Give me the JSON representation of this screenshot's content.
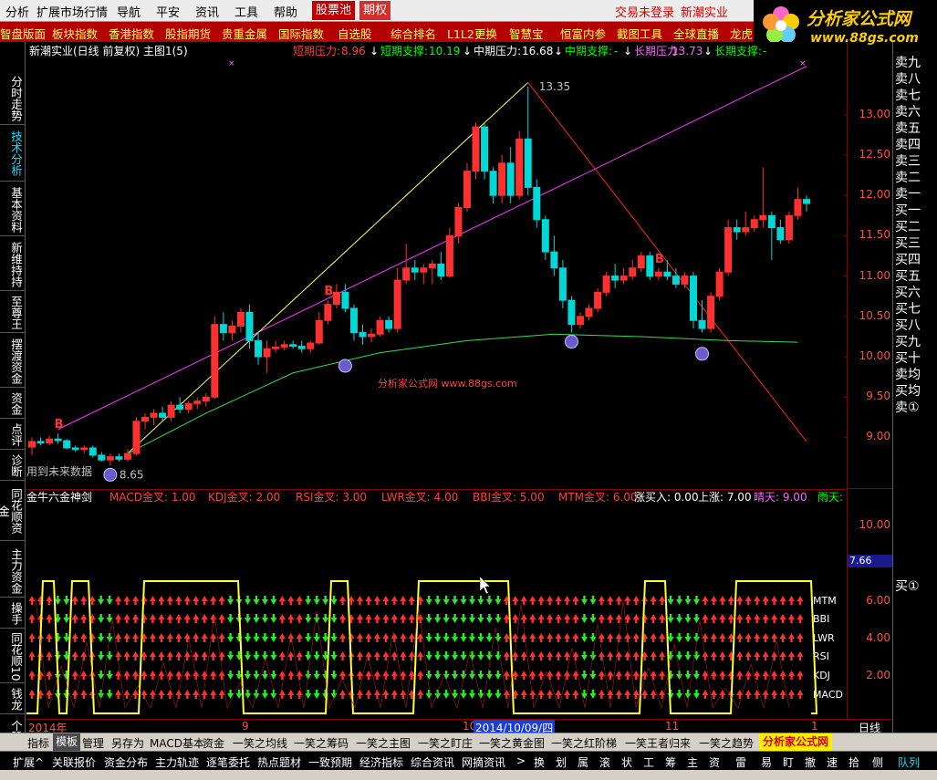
{
  "menu": {
    "items": [
      "分析",
      "扩展市场行情",
      "导航",
      "平安",
      "资讯",
      "工具",
      "帮助",
      "股票池",
      "期权"
    ],
    "status_login": "交易未登录",
    "status_stock": "新潮实业"
  },
  "quickbar": [
    "智盘版面",
    "板块指数",
    "香港指数",
    "股指期货",
    "贵重金属",
    "国际指数",
    "自选股",
    "综合排名",
    "L1L2更换",
    "智慧宝",
    "恒富内参",
    "截图工具",
    "全球直播",
    "龙虎"
  ],
  "logo": {
    "title": "分析家公式网",
    "url": "www.88gs.com"
  },
  "leftnav": [
    "分时走势",
    "技术分析",
    "基本资料",
    "新维持持",
    "至尊王",
    "摆渡资金",
    "资金",
    "点评",
    "诊断",
    "同花顺资金",
    "主力资金",
    "操手",
    "同花顺10",
    "钱龙",
    "个股"
  ],
  "rightnav": [
    "卖九",
    "卖八",
    "卖七",
    "卖六",
    "卖五",
    "卖四",
    "卖三",
    "卖二",
    "卖一",
    "买一",
    "买二",
    "买三",
    "买四",
    "买五",
    "买六",
    "买七",
    "买八",
    "买九",
    "买十",
    "卖均",
    "买均",
    "卖①"
  ],
  "rightnav_bottom": "买①",
  "chart_header": {
    "stock_title": "新潮实业(日线 前复权) 主图1(5)",
    "short_resist_label": "短期压力:",
    "short_resist_val": "8.96",
    "short_support_label": "短期支撑:",
    "short_support_val": "10.19",
    "mid_resist_label": "中期压力:",
    "mid_resist_val": "16.68",
    "mid_support_label": "中期支撑:",
    "mid_support_val": "-",
    "long_resist_label": "长期压力:",
    "long_resist_val": "13.73",
    "long_support_label": "长期支撑:",
    "long_support_val": "-"
  },
  "indicator_header": {
    "name": "金牛六金神剑",
    "macd": "MACD金叉: 1.00",
    "kdj": "KDJ金叉: 2.00",
    "rsi": "RSI金叉: 3.00",
    "lwr": "LWR金叉: 4.00",
    "bbi": "BBI金叉: 5.00",
    "mtm": "MTM金叉: 6.00",
    "up_buy": "涨买入: 0.00",
    "up": "上涨: 7.00",
    "sunny": "晴天: 9.00",
    "rain": "雨天:"
  },
  "chart_annotations": {
    "high_price": "13.35",
    "low_price": "8.65",
    "future_data_note": "用到未来数据",
    "watermark": "分析家公式网 www.88gs.com",
    "b_marker": "B",
    "date_label_2014": "2014年",
    "month_9": "9",
    "month_10": "10",
    "month_11": "11",
    "month_1": "1",
    "cursor_date": "2014/10/09/四",
    "period": "日线",
    "indicator_value_box": "7.66"
  },
  "indicator_row_labels": [
    "MTM",
    "BBI",
    "LWR",
    "RSI",
    "KDJ",
    "MACD"
  ],
  "axis": {
    "price_ticks": [
      "13.00",
      "12.50",
      "12.00",
      "11.50",
      "11.00",
      "10.50",
      "10.00",
      "9.50",
      "9.00"
    ],
    "indicator_ticks": [
      "10.00",
      "6.00",
      "4.00",
      "2.00"
    ]
  },
  "tabs": [
    "指标",
    "模板",
    "管理",
    "另存为",
    "MACD基本",
    "资金",
    "一笑之均线",
    "一笑之筹码",
    "一笑之主图",
    "一笑之盯庄",
    "一笑之黄金图",
    "一笑之红阶梯",
    "一笑王者归来",
    "一笑之趋势"
  ],
  "tabs_active_index": 1,
  "tabs_brand": "分析家公式网",
  "bottombar": [
    "扩展^",
    "关联报价",
    "资金分布",
    "主力轨迹",
    "逐笔委托",
    "热点题材",
    "一致预期",
    "经济指标",
    "综合资讯",
    "网摘资讯",
    ">",
    "换",
    "划",
    "属",
    "滚",
    "状",
    "工",
    "筹",
    "主",
    "资",
    "雷",
    "易",
    "盯",
    "撤",
    "速",
    "拾",
    "侧",
    "队列"
  ],
  "colors": {
    "up": "#ff3333",
    "down": "#00d8d8",
    "accent_red": "#b30000",
    "menu_bg": "#ececec"
  },
  "chart_data": {
    "type": "candlestick",
    "title": "新潮实业(日线 前复权)",
    "ylim": [
      8.7,
      13.45
    ],
    "y_ticks": [
      9.0,
      9.5,
      10.0,
      10.5,
      11.0,
      11.5,
      12.0,
      12.5,
      13.0
    ],
    "candles": [
      {
        "o": 8.88,
        "h": 9.0,
        "l": 8.78,
        "c": 8.95
      },
      {
        "o": 8.95,
        "h": 9.0,
        "l": 8.9,
        "c": 8.93
      },
      {
        "o": 8.93,
        "h": 9.02,
        "l": 8.9,
        "c": 8.98
      },
      {
        "o": 8.98,
        "h": 9.05,
        "l": 8.92,
        "c": 8.96
      },
      {
        "o": 8.96,
        "h": 8.98,
        "l": 8.85,
        "c": 8.87
      },
      {
        "o": 8.87,
        "h": 8.9,
        "l": 8.82,
        "c": 8.85
      },
      {
        "o": 8.85,
        "h": 8.9,
        "l": 8.8,
        "c": 8.87
      },
      {
        "o": 8.87,
        "h": 8.9,
        "l": 8.75,
        "c": 8.78
      },
      {
        "o": 8.78,
        "h": 8.82,
        "l": 8.7,
        "c": 8.72
      },
      {
        "o": 8.72,
        "h": 8.8,
        "l": 8.65,
        "c": 8.76
      },
      {
        "o": 8.76,
        "h": 8.8,
        "l": 8.7,
        "c": 8.73
      },
      {
        "o": 8.73,
        "h": 8.85,
        "l": 8.7,
        "c": 8.8
      },
      {
        "o": 8.8,
        "h": 9.25,
        "l": 8.78,
        "c": 9.2
      },
      {
        "o": 9.2,
        "h": 9.3,
        "l": 9.1,
        "c": 9.25
      },
      {
        "o": 9.25,
        "h": 9.35,
        "l": 9.15,
        "c": 9.3
      },
      {
        "o": 9.3,
        "h": 9.38,
        "l": 9.2,
        "c": 9.25
      },
      {
        "o": 9.25,
        "h": 9.45,
        "l": 9.2,
        "c": 9.4
      },
      {
        "o": 9.4,
        "h": 9.5,
        "l": 9.3,
        "c": 9.35
      },
      {
        "o": 9.35,
        "h": 9.45,
        "l": 9.3,
        "c": 9.42
      },
      {
        "o": 9.42,
        "h": 9.5,
        "l": 9.35,
        "c": 9.45
      },
      {
        "o": 9.45,
        "h": 9.55,
        "l": 9.38,
        "c": 9.5
      },
      {
        "o": 9.5,
        "h": 10.5,
        "l": 9.48,
        "c": 10.4
      },
      {
        "o": 10.4,
        "h": 10.55,
        "l": 10.2,
        "c": 10.3
      },
      {
        "o": 10.3,
        "h": 10.45,
        "l": 10.2,
        "c": 10.38
      },
      {
        "o": 10.38,
        "h": 10.6,
        "l": 10.3,
        "c": 10.55
      },
      {
        "o": 10.55,
        "h": 10.65,
        "l": 10.1,
        "c": 10.2
      },
      {
        "o": 10.2,
        "h": 10.3,
        "l": 9.9,
        "c": 10.0
      },
      {
        "o": 10.0,
        "h": 10.2,
        "l": 9.8,
        "c": 10.1
      },
      {
        "o": 10.1,
        "h": 10.2,
        "l": 10.05,
        "c": 10.12
      },
      {
        "o": 10.12,
        "h": 10.2,
        "l": 10.08,
        "c": 10.15
      },
      {
        "o": 10.15,
        "h": 10.2,
        "l": 10.1,
        "c": 10.13
      },
      {
        "o": 10.13,
        "h": 10.2,
        "l": 10.05,
        "c": 10.1
      },
      {
        "o": 10.1,
        "h": 10.2,
        "l": 10.05,
        "c": 10.17
      },
      {
        "o": 10.17,
        "h": 10.55,
        "l": 10.15,
        "c": 10.45
      },
      {
        "o": 10.45,
        "h": 10.7,
        "l": 10.4,
        "c": 10.65
      },
      {
        "o": 10.65,
        "h": 10.9,
        "l": 10.6,
        "c": 10.8
      },
      {
        "o": 10.8,
        "h": 10.9,
        "l": 10.55,
        "c": 10.6
      },
      {
        "o": 10.6,
        "h": 10.65,
        "l": 10.2,
        "c": 10.3
      },
      {
        "o": 10.3,
        "h": 10.4,
        "l": 10.15,
        "c": 10.25
      },
      {
        "o": 10.25,
        "h": 10.35,
        "l": 10.18,
        "c": 10.28
      },
      {
        "o": 10.28,
        "h": 10.5,
        "l": 10.25,
        "c": 10.45
      },
      {
        "o": 10.45,
        "h": 10.5,
        "l": 10.3,
        "c": 10.35
      },
      {
        "o": 10.35,
        "h": 11.1,
        "l": 10.3,
        "c": 10.95
      },
      {
        "o": 10.95,
        "h": 11.4,
        "l": 10.9,
        "c": 11.1
      },
      {
        "o": 11.1,
        "h": 11.2,
        "l": 10.95,
        "c": 11.05
      },
      {
        "o": 11.05,
        "h": 11.15,
        "l": 10.9,
        "c": 11.1
      },
      {
        "o": 11.1,
        "h": 11.2,
        "l": 10.9,
        "c": 11.15
      },
      {
        "o": 11.15,
        "h": 11.3,
        "l": 10.95,
        "c": 11.0
      },
      {
        "o": 11.0,
        "h": 11.6,
        "l": 10.98,
        "c": 11.5
      },
      {
        "o": 11.5,
        "h": 11.9,
        "l": 11.4,
        "c": 11.85
      },
      {
        "o": 11.85,
        "h": 12.4,
        "l": 11.8,
        "c": 12.3
      },
      {
        "o": 12.3,
        "h": 12.9,
        "l": 12.2,
        "c": 12.85
      },
      {
        "o": 12.85,
        "h": 12.9,
        "l": 12.2,
        "c": 12.3
      },
      {
        "o": 12.3,
        "h": 12.35,
        "l": 11.9,
        "c": 12.0
      },
      {
        "o": 12.0,
        "h": 12.5,
        "l": 11.9,
        "c": 12.4
      },
      {
        "o": 12.4,
        "h": 12.6,
        "l": 11.9,
        "c": 12.0
      },
      {
        "o": 12.0,
        "h": 12.8,
        "l": 11.95,
        "c": 12.7
      },
      {
        "o": 12.7,
        "h": 13.35,
        "l": 12.0,
        "c": 12.1
      },
      {
        "o": 12.1,
        "h": 12.2,
        "l": 11.6,
        "c": 11.7
      },
      {
        "o": 11.7,
        "h": 11.75,
        "l": 11.2,
        "c": 11.3
      },
      {
        "o": 11.3,
        "h": 11.5,
        "l": 11.0,
        "c": 11.1
      },
      {
        "o": 11.1,
        "h": 11.2,
        "l": 10.6,
        "c": 10.7
      },
      {
        "o": 10.7,
        "h": 10.75,
        "l": 10.3,
        "c": 10.4
      },
      {
        "o": 10.4,
        "h": 10.55,
        "l": 10.35,
        "c": 10.5
      },
      {
        "o": 10.5,
        "h": 10.65,
        "l": 10.45,
        "c": 10.6
      },
      {
        "o": 10.6,
        "h": 10.85,
        "l": 10.55,
        "c": 10.8
      },
      {
        "o": 10.8,
        "h": 11.05,
        "l": 10.75,
        "c": 11.0
      },
      {
        "o": 11.0,
        "h": 11.15,
        "l": 10.85,
        "c": 10.95
      },
      {
        "o": 10.95,
        "h": 11.1,
        "l": 10.9,
        "c": 11.0
      },
      {
        "o": 11.0,
        "h": 11.2,
        "l": 10.95,
        "c": 11.1
      },
      {
        "o": 11.1,
        "h": 11.3,
        "l": 11.05,
        "c": 11.25
      },
      {
        "o": 11.25,
        "h": 11.3,
        "l": 10.95,
        "c": 11.0
      },
      {
        "o": 11.0,
        "h": 11.1,
        "l": 10.95,
        "c": 11.05
      },
      {
        "o": 11.05,
        "h": 11.2,
        "l": 10.95,
        "c": 11.0
      },
      {
        "o": 11.0,
        "h": 11.1,
        "l": 10.85,
        "c": 10.9
      },
      {
        "o": 10.9,
        "h": 11.05,
        "l": 10.85,
        "c": 11.0
      },
      {
        "o": 11.0,
        "h": 11.05,
        "l": 10.35,
        "c": 10.45
      },
      {
        "o": 10.45,
        "h": 10.7,
        "l": 10.3,
        "c": 10.35
      },
      {
        "o": 10.35,
        "h": 10.8,
        "l": 10.3,
        "c": 10.75
      },
      {
        "o": 10.75,
        "h": 11.1,
        "l": 10.7,
        "c": 11.05
      },
      {
        "o": 11.05,
        "h": 11.7,
        "l": 11.0,
        "c": 11.6
      },
      {
        "o": 11.6,
        "h": 11.7,
        "l": 11.45,
        "c": 11.55
      },
      {
        "o": 11.55,
        "h": 11.8,
        "l": 11.5,
        "c": 11.6
      },
      {
        "o": 11.6,
        "h": 11.75,
        "l": 11.55,
        "c": 11.7
      },
      {
        "o": 11.7,
        "h": 12.35,
        "l": 11.6,
        "c": 11.75
      },
      {
        "o": 11.75,
        "h": 11.8,
        "l": 11.2,
        "c": 11.6
      },
      {
        "o": 11.6,
        "h": 11.7,
        "l": 11.4,
        "c": 11.45
      },
      {
        "o": 11.45,
        "h": 11.8,
        "l": 11.4,
        "c": 11.75
      },
      {
        "o": 11.75,
        "h": 12.1,
        "l": 11.7,
        "c": 11.95
      },
      {
        "o": 11.95,
        "h": 12.0,
        "l": 11.8,
        "c": 11.9
      }
    ],
    "high_marker": {
      "index": 57,
      "value": 13.35
    },
    "low_marker": {
      "index": 9,
      "value": 8.65
    },
    "trendlines": [
      {
        "name": "magenta",
        "from": [
          3,
          9.1
        ],
        "to": [
          89,
          13.6
        ]
      },
      {
        "name": "yellow",
        "from": [
          11,
          8.8
        ],
        "to": [
          57,
          13.4
        ]
      },
      {
        "name": "red",
        "from": [
          57,
          13.4
        ],
        "to": [
          89,
          8.95
        ]
      }
    ],
    "ma_curve": [
      [
        11,
        8.8
      ],
      [
        20,
        9.3
      ],
      [
        30,
        9.8
      ],
      [
        40,
        10.05
      ],
      [
        50,
        10.2
      ],
      [
        60,
        10.28
      ],
      [
        70,
        10.25
      ],
      [
        80,
        10.2
      ],
      [
        88,
        10.18
      ]
    ],
    "b_markers": [
      3,
      34,
      72
    ],
    "face_markers": [
      {
        "index": 9,
        "value": 8.65
      },
      {
        "index": 36,
        "value": 10.0
      },
      {
        "index": 62,
        "value": 10.3
      },
      {
        "index": 77,
        "value": 10.15
      }
    ]
  }
}
